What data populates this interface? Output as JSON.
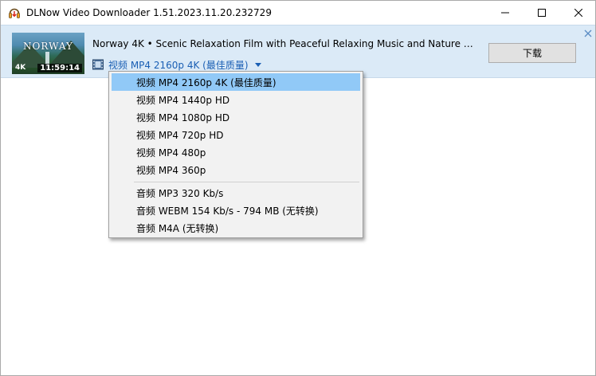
{
  "window": {
    "title": "DLNow Video Downloader 1.51.2023.11.20.232729",
    "icon": "headphones-download-icon",
    "controls": [
      "minimize-icon",
      "maximize-icon",
      "close-icon"
    ]
  },
  "item": {
    "thumbnail": {
      "title": "NORWAY",
      "badge": "4K",
      "duration": "11:59:14"
    },
    "title": "Norway 4K • Scenic Relaxation Film with Peaceful Relaxing Music and Nature Vide...",
    "selected_format": "视频 MP4 2160p 4K (最佳质量)",
    "download_label": "下载"
  },
  "menu": {
    "video_options": [
      "视频 MP4 2160p 4K (最佳质量)",
      "视频 MP4 1440p HD",
      "视频 MP4 1080p HD",
      "视频 MP4 720p HD",
      "视频 MP4 480p",
      "视频 MP4 360p"
    ],
    "audio_options": [
      "音频 MP3 320 Kb/s",
      "音频 WEBM 154 Kb/s - 794 MB (无转换)",
      "音频 M4A (无转换)"
    ]
  },
  "colors": {
    "item_bar": "#dbeaf7",
    "link_blue": "#1a5fb4",
    "menu_highlight": "#91c9f7"
  }
}
